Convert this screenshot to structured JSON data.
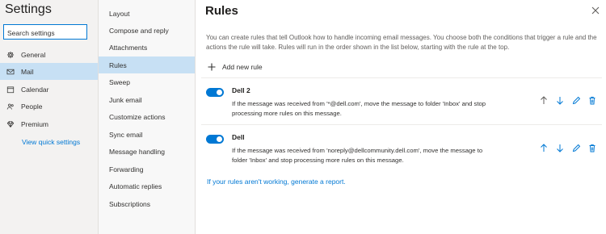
{
  "settings": {
    "title": "Settings",
    "search_placeholder": "Search settings",
    "categories": [
      {
        "label": "General",
        "icon": "gear-icon"
      },
      {
        "label": "Mail",
        "icon": "mail-icon",
        "active": true
      },
      {
        "label": "Calendar",
        "icon": "calendar-icon"
      },
      {
        "label": "People",
        "icon": "people-icon"
      },
      {
        "label": "Premium",
        "icon": "diamond-icon"
      }
    ],
    "quick_link": "View quick settings"
  },
  "mail_menu": {
    "items": [
      "Layout",
      "Compose and reply",
      "Attachments",
      "Rules",
      "Sweep",
      "Junk email",
      "Customize actions",
      "Sync email",
      "Message handling",
      "Forwarding",
      "Automatic replies",
      "Subscriptions"
    ],
    "active_index": 3
  },
  "rules_page": {
    "title": "Rules",
    "intro": "You can create rules that tell Outlook how to handle incoming email messages. You choose both the conditions that trigger a rule and the actions the rule will take. Rules will run in the order shown in the list below, starting with the rule at the top.",
    "add_rule_label": "Add new rule",
    "rules": [
      {
        "name": "Dell 2",
        "enabled": true,
        "description": "If the message was received from '*@dell.com', move the message to folder 'Inbox' and stop processing more rules on this message."
      },
      {
        "name": "Dell",
        "enabled": true,
        "description": "If the message was received from 'noreply@dellcommunity.dell.com', move the message to folder 'Inbox' and stop processing more rules on this message."
      }
    ],
    "report_link": "If your rules aren't working, generate a report."
  },
  "colors": {
    "accent": "#0078d4",
    "selected_bg": "#c7e0f4",
    "left_pane_bg": "#f3f2f1"
  }
}
